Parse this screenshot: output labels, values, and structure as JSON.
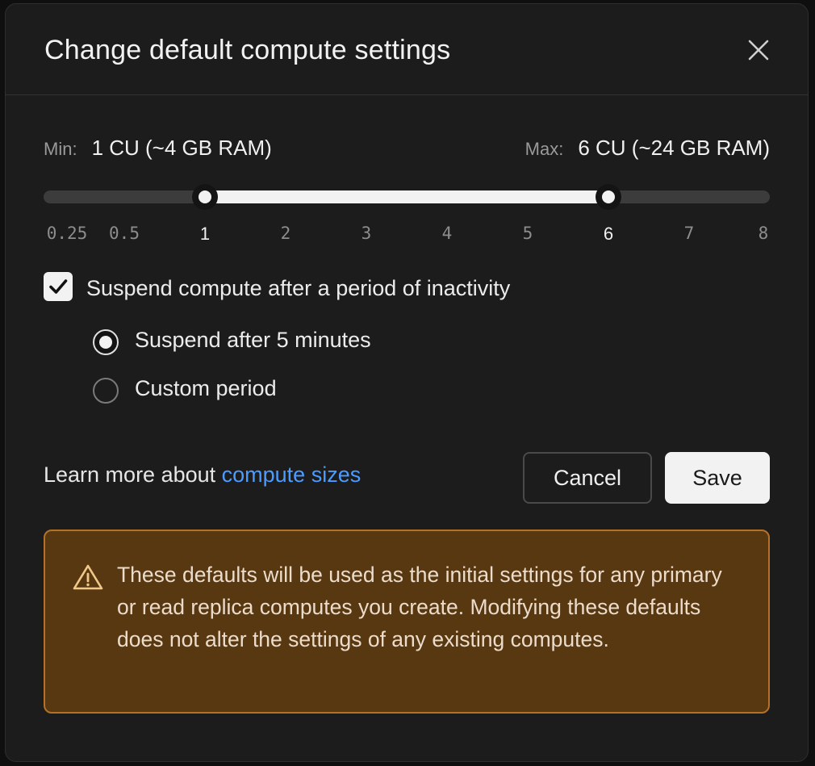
{
  "dialog": {
    "title": "Change default compute settings",
    "close_icon": "close-icon"
  },
  "slider": {
    "min_label": "Min:",
    "min_value": "1 CU (~4 GB RAM)",
    "max_label": "Max:",
    "max_value": "6 CU (~24 GB RAM)",
    "ticks": [
      "0.25",
      "0.5",
      "1",
      "2",
      "3",
      "4",
      "5",
      "6",
      "7",
      "8"
    ],
    "selected_min": 1,
    "selected_max": 6
  },
  "suspend": {
    "checkbox_label": "Suspend compute after a period of inactivity",
    "checked": true,
    "options": [
      {
        "label": "Suspend after 5 minutes",
        "selected": true
      },
      {
        "label": "Custom period",
        "selected": false
      }
    ]
  },
  "footer": {
    "learn_prefix": "Learn more about ",
    "learn_link": "compute sizes",
    "cancel_label": "Cancel",
    "save_label": "Save"
  },
  "warning": {
    "icon": "warning-icon",
    "text": "These defaults will be used as the initial settings for any primary or read replica computes you create. Modifying these defaults does not alter the settings of any existing computes."
  },
  "background": {
    "peek_button_label": "Save"
  },
  "colors": {
    "link": "#4c9bff",
    "warning_bg": "#583811",
    "warning_border": "#b3712a"
  }
}
